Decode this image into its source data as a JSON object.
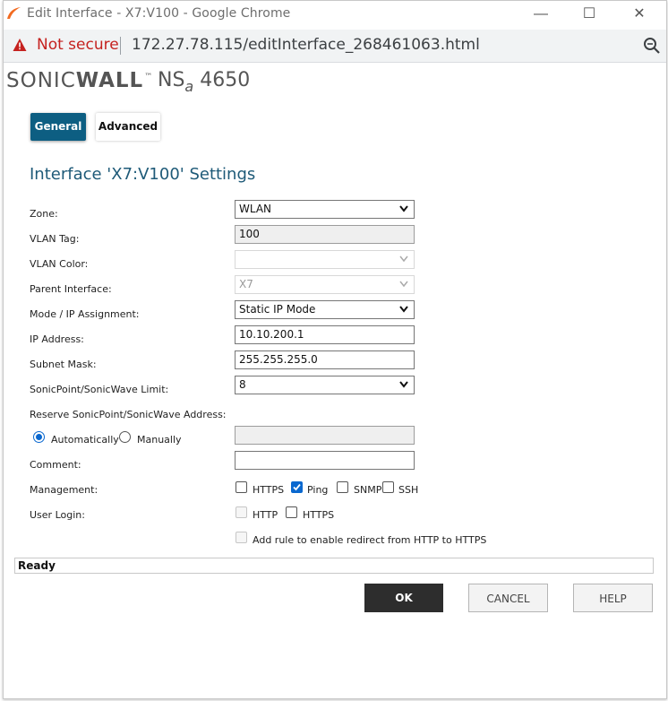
{
  "window": {
    "title": "Edit Interface - X7:V100 - Google Chrome",
    "minimize_glyph": "—",
    "maximize_glyph": "☐",
    "close_glyph": "✕"
  },
  "address_bar": {
    "security_label": "Not secure",
    "url": "172.27.78.115/editInterface_268461063.html"
  },
  "brand": {
    "logo_text_1": "SONIC",
    "logo_text_2": "WALL",
    "tm": "™",
    "model_prefix": "NS",
    "model_sub": "a",
    "model_number": "4650"
  },
  "tabs": [
    {
      "label": "General",
      "active": true
    },
    {
      "label": "Advanced",
      "active": false
    }
  ],
  "heading": "Interface 'X7:V100' Settings",
  "form": {
    "zone": {
      "label": "Zone:",
      "value": "WLAN"
    },
    "vlan_tag": {
      "label": "VLAN Tag:",
      "value": "100"
    },
    "vlan_color": {
      "label": "VLAN Color:",
      "value": ""
    },
    "parent_interface": {
      "label": "Parent Interface:",
      "value": "X7"
    },
    "mode": {
      "label": "Mode / IP Assignment:",
      "value": "Static IP Mode"
    },
    "ip_address": {
      "label": "IP Address:",
      "value": "10.10.200.1"
    },
    "subnet_mask": {
      "label": "Subnet Mask:",
      "value": "255.255.255.0"
    },
    "sonicpoint_limit": {
      "label": "SonicPoint/SonicWave Limit:",
      "value": "8"
    },
    "reserve": {
      "label": "Reserve SonicPoint/SonicWave Address:",
      "option_auto": "Automatically",
      "option_manual": "Manually",
      "selected": "Automatically",
      "value": ""
    },
    "comment": {
      "label": "Comment:",
      "value": ""
    },
    "management": {
      "label": "Management:",
      "options": [
        {
          "label": "HTTPS",
          "checked": false
        },
        {
          "label": "Ping",
          "checked": true
        },
        {
          "label": "SNMP",
          "checked": false
        },
        {
          "label": "SSH",
          "checked": false
        }
      ]
    },
    "user_login": {
      "label": "User Login:",
      "options": [
        {
          "label": "HTTP",
          "checked": false,
          "disabled": true
        },
        {
          "label": "HTTPS",
          "checked": false,
          "disabled": false
        }
      ]
    },
    "redirect": {
      "label": "Add rule to enable redirect from HTTP to HTTPS",
      "checked": false,
      "disabled": true
    }
  },
  "status": "Ready",
  "buttons": {
    "ok": "OK",
    "cancel": "CANCEL",
    "help": "HELP"
  },
  "colors": {
    "accent": "#0d5e82",
    "heading": "#1e5a78",
    "warning": "#c5221f",
    "check": "#0a68cf"
  }
}
